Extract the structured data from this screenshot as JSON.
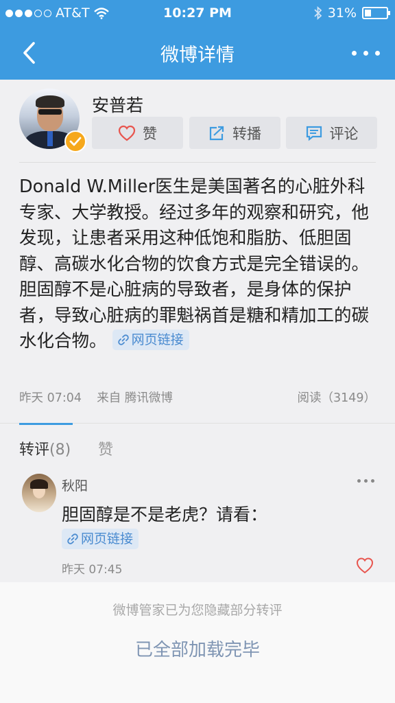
{
  "status": {
    "carrier": "AT&T",
    "time": "10:27 PM",
    "battery": "31%",
    "battery_level": 0.31
  },
  "nav": {
    "title": "微博详情"
  },
  "post": {
    "author": "安普若",
    "actions": {
      "like": "赞",
      "repost": "转播",
      "comment": "评论"
    },
    "content": "Donald W.Miller医生是美国著名的心脏外科专家、大学教授。经过多年的观察和研究，他发现，让患者采用这种低饱和脂肪、低胆固醇、高碳水化合物的饮食方式是完全错误的。胆固醇不是心脏病的导致者，是身体的保护者，导致心脏病的罪魁祸首是糖和精加工的碳水化合物。",
    "link_label": "网页链接",
    "time": "昨天 07:04",
    "source": "来自 腾讯微博",
    "reads": "阅读（3149）"
  },
  "tabs": {
    "repost": "转评",
    "repost_count": "(8)",
    "like": "赞"
  },
  "comment": {
    "name": "秋阳",
    "text": "胆固醇是不是老虎？请看：",
    "link_label": "网页链接",
    "time": "昨天 07:45"
  },
  "footer": {
    "hidden_note": "微博管家已为您隐藏部分转评",
    "load_done": "已全部加载完毕"
  },
  "colors": {
    "accent": "#3d9be0",
    "link": "#4a8bd0",
    "like": "#e8554e",
    "badge": "#f6a81c"
  },
  "icons": [
    "signal-dots-icon",
    "wifi-icon",
    "bluetooth-icon",
    "battery-icon",
    "back-arrow-icon",
    "more-icon",
    "heart-icon",
    "share-icon",
    "comment-icon",
    "link-icon",
    "verified-badge-icon"
  ]
}
